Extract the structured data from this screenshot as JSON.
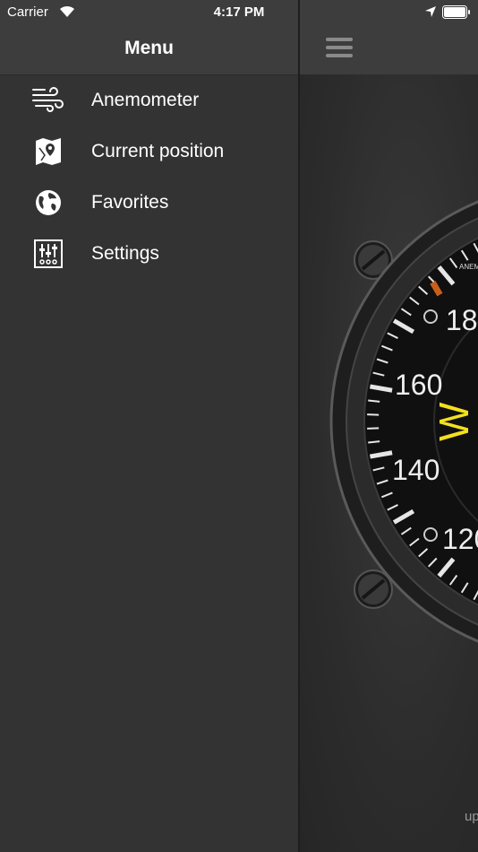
{
  "status_bar": {
    "carrier": "Carrier",
    "time": "4:17 PM"
  },
  "menu": {
    "title": "Menu",
    "items": [
      {
        "label": "Anemometer",
        "icon": "wind-icon"
      },
      {
        "label": "Current position",
        "icon": "map-pin-icon"
      },
      {
        "label": "Favorites",
        "icon": "globe-icon"
      },
      {
        "label": "Settings",
        "icon": "sliders-icon"
      }
    ]
  },
  "gauge": {
    "brand_text": "ANEM",
    "dial_labels": [
      "180",
      "160",
      "140",
      "120"
    ],
    "direction_label": "W",
    "accent_color": "#f2e01e",
    "marker_color": "#c8601a"
  },
  "footer": {
    "partial_text": "up"
  }
}
